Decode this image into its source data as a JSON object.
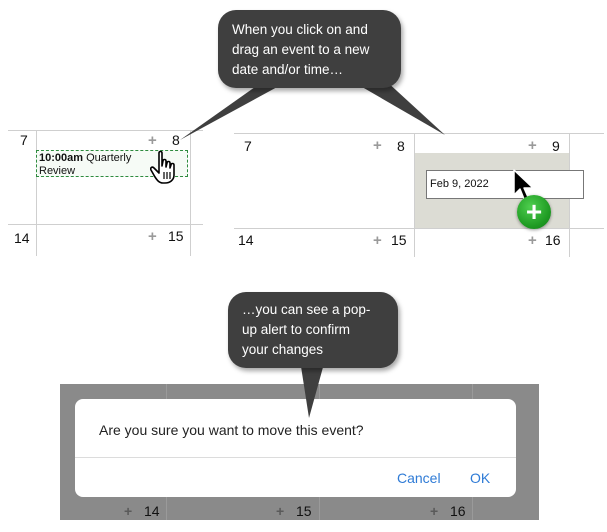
{
  "callouts": {
    "top_lines": [
      "When you click on and",
      "drag an event to a new",
      "date and/or time…"
    ],
    "bottom_lines": [
      "…you can see a pop-",
      "up alert to confirm",
      "your changes"
    ]
  },
  "left_calendar": {
    "days": [
      "7",
      "8",
      "14",
      "15"
    ],
    "event": {
      "time": "10:00am",
      "title_line1": "Quarterly",
      "title_line2": "Review"
    }
  },
  "right_calendar": {
    "days": [
      "7",
      "8",
      "9",
      "14",
      "15",
      "16"
    ],
    "drop_date": "Feb 9, 2022"
  },
  "icons": {
    "add": "plus-icon",
    "cursor_hand": "hand-pointer-icon",
    "cursor_arrow": "arrow-cursor-icon",
    "add_badge": "add-circle-icon"
  },
  "colors": {
    "event_border": "#2e8b3e",
    "drop_highlight": "#dcdcd4",
    "dialog_button": "#2f7bd6",
    "callout_bg": "#3f3f3f"
  },
  "dialog": {
    "message": "Are you sure you want to move this event?",
    "cancel_label": "Cancel",
    "ok_label": "OK",
    "bg_days": [
      "14",
      "15",
      "16"
    ]
  }
}
